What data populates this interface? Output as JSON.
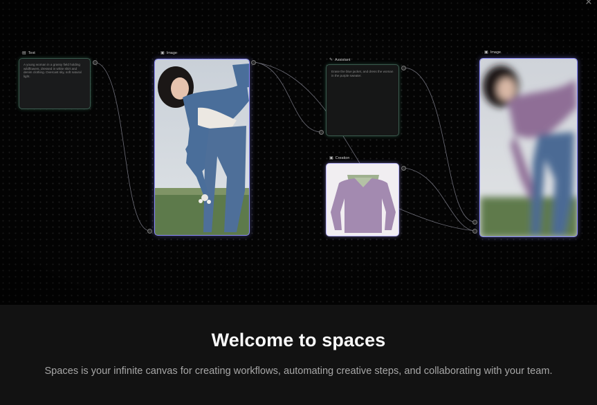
{
  "canvas": {
    "close_icon": "close-icon",
    "nodes": {
      "text": {
        "label": "Text",
        "icon": "text-icon",
        "content": "A young woman in a grassy field holding wildflowers, dressed in white shirt and denim clothing. Overcast sky, soft natural light."
      },
      "image1": {
        "label": "Image",
        "icon": "image-icon"
      },
      "assistant": {
        "label": "Assistant",
        "icon": "sparkle-icon",
        "content": "Erase the blue jacket, and dress the woman in the purple sweater."
      },
      "creation": {
        "label": "Creation",
        "icon": "image-icon"
      },
      "image2": {
        "label": "Image",
        "icon": "image-icon"
      }
    },
    "colors": {
      "node_border_green": "#3b5a4e",
      "node_border_purple": "#8d8cff",
      "edge": "#6f6f7a"
    }
  },
  "welcome": {
    "title": "Welcome to spaces",
    "description": "Spaces is your infinite canvas for creating workflows, automating creative steps, and collaborating with your team."
  }
}
